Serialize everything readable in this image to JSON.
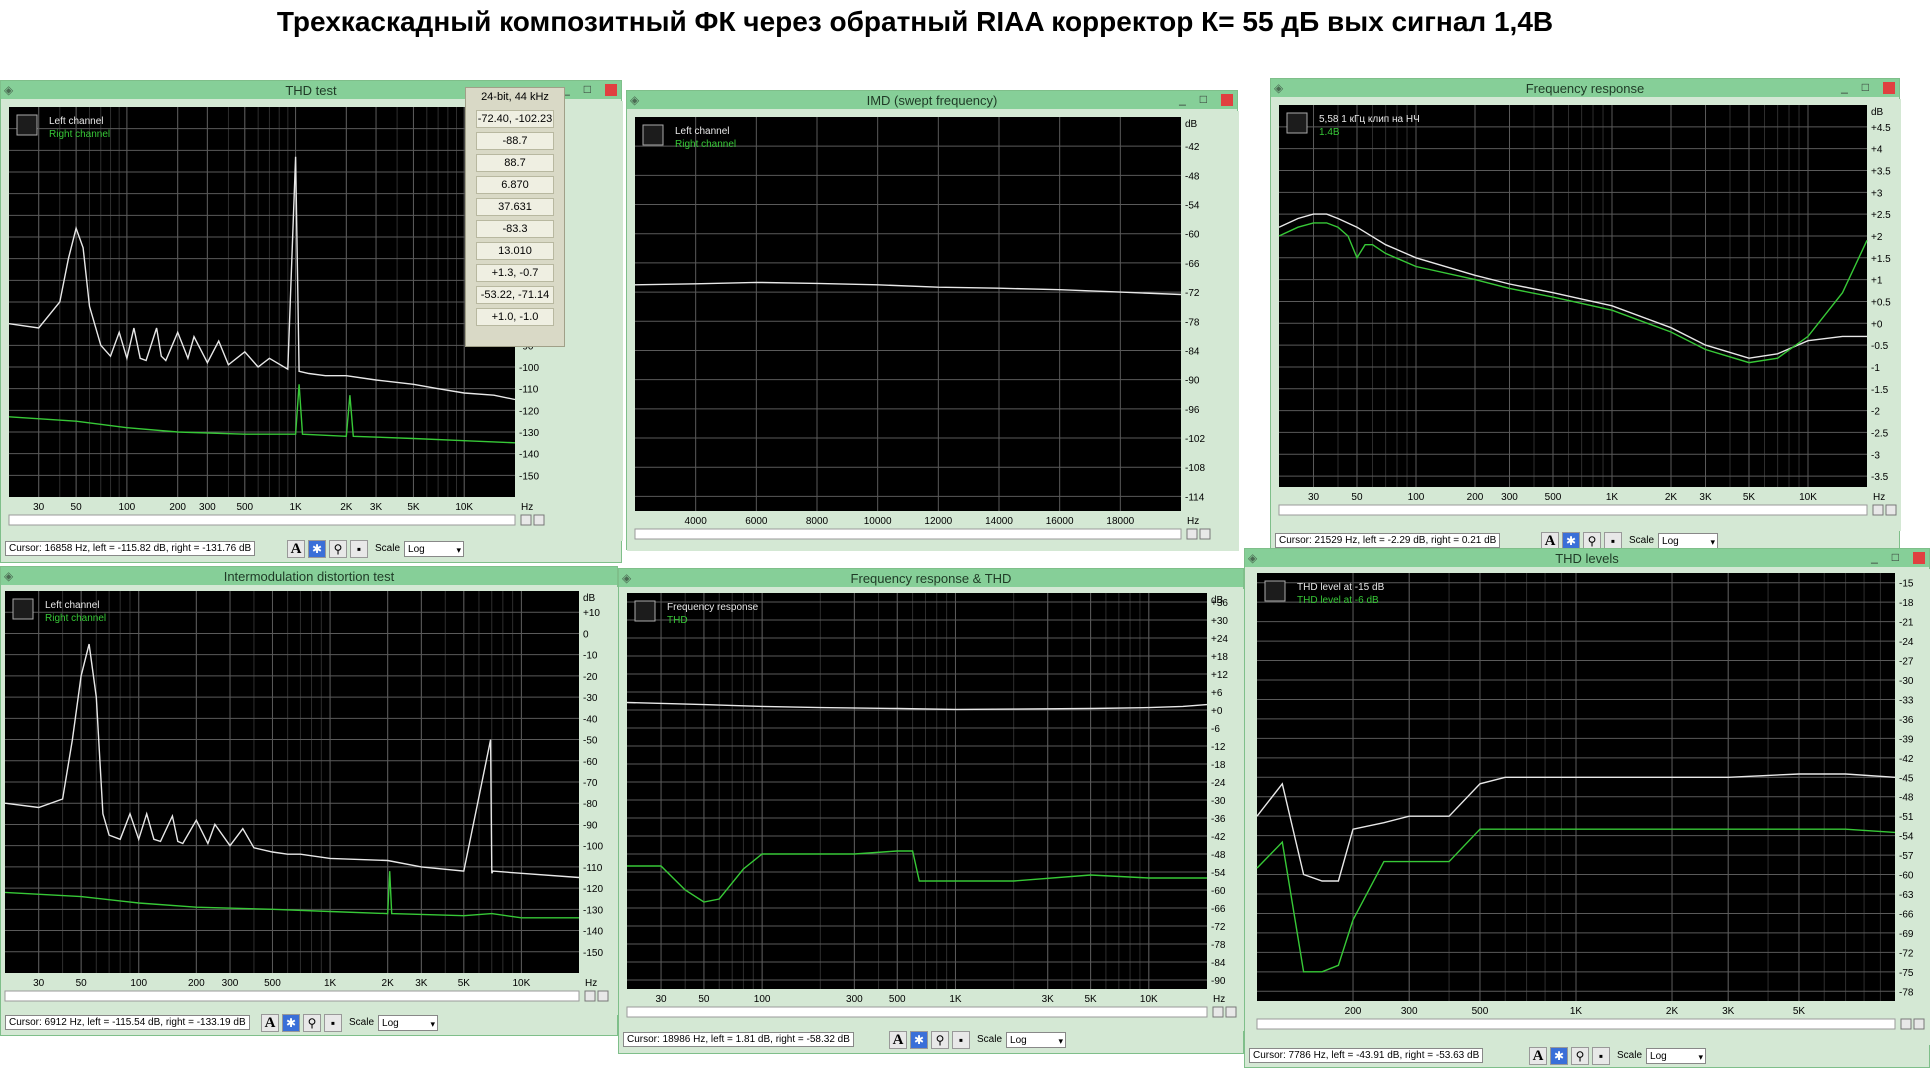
{
  "page_title": "Трехкаскадный композитный ФК через обратный  RIAA корректор К= 55 дБ  вых сигнал 1,4В",
  "colors": {
    "plot_bg": "#000000",
    "grid": "#5a5a5a",
    "left": "#e8e8e8",
    "right": "#37c837",
    "window": "#d4e8d4",
    "titlebar": "#86cf98"
  },
  "scale": {
    "label": "Scale",
    "value": "Log"
  },
  "windows": {
    "thd_test": {
      "title": "THD test",
      "legend": [
        "Left channel",
        "Right channel"
      ],
      "cursor": "Cursor:  16858 Hz,  left = -115.82 dB,  right = -131.76 dB",
      "panel": {
        "header": "24-bit, 44 kHz",
        "values": [
          "-72.40, -102.23",
          "-88.7",
          "88.7",
          "6.870",
          "37.631",
          "-83.3",
          "13.010",
          "+1.3, -0.7",
          "-53.22, -71.14",
          "+1.0, -1.0"
        ]
      }
    },
    "imd_swept": {
      "title": "IMD (swept frequency)",
      "legend": [
        "Left channel",
        "Right channel"
      ],
      "cursor": ""
    },
    "freq_response": {
      "title": "Frequency response",
      "legend": [
        "5,58 1 кГц клип на НЧ",
        "1.4В"
      ],
      "cursor": "Cursor:  21529 Hz,  left = -2.29 dB,  right = 0.21 dB"
    },
    "imd_test": {
      "title": "Intermodulation distortion test",
      "legend": [
        "Left channel",
        "Right channel"
      ],
      "cursor": "Cursor:  6912 Hz,  left = -115.54 dB,  right = -133.19 dB"
    },
    "fr_thd": {
      "title": "Frequency response & THD",
      "legend": [
        "Frequency response",
        "THD"
      ],
      "cursor": "Cursor:  18986 Hz,  left = 1.81 dB,  right = -58.32 dB"
    },
    "thd_levels": {
      "title": "THD levels",
      "legend": [
        "THD level at -15 dB",
        "THD level at -6 dB"
      ],
      "cursor": "Cursor:  7786 Hz,  left = -43.91 dB,  right = -53.63 dB"
    }
  },
  "chart_data": [
    {
      "id": "thd_test",
      "type": "line",
      "xscale": "log",
      "xlim": [
        20,
        20000
      ],
      "xticks": [
        {
          "v": 30,
          "l": "30"
        },
        {
          "v": 50,
          "l": "50"
        },
        {
          "v": 100,
          "l": "100"
        },
        {
          "v": 200,
          "l": "200"
        },
        {
          "v": 300,
          "l": "300"
        },
        {
          "v": 500,
          "l": "500"
        },
        {
          "v": 1000,
          "l": "1K"
        },
        {
          "v": 2000,
          "l": "2K"
        },
        {
          "v": 3000,
          "l": "3K"
        },
        {
          "v": 5000,
          "l": "5K"
        },
        {
          "v": 10000,
          "l": "10K"
        }
      ],
      "xunit": "Hz",
      "yticks": [
        "+10",
        "0",
        "-10",
        "-20",
        "-30",
        "-40",
        "-50",
        "-60",
        "-70",
        "-80",
        "-90",
        "-100",
        "-110",
        "-120",
        "-130",
        "-140",
        "-150"
      ],
      "yunit": "dB",
      "ylim": [
        -160,
        20
      ],
      "series": [
        {
          "name": "Left channel",
          "x": [
            20,
            30,
            40,
            45,
            50,
            55,
            60,
            70,
            80,
            90,
            100,
            110,
            120,
            130,
            150,
            160,
            170,
            200,
            230,
            250,
            300,
            350,
            400,
            500,
            600,
            700,
            900,
            1000,
            1050,
            1200,
            1500,
            2000,
            3000,
            5000,
            7000,
            10000,
            15000,
            20000
          ],
          "y": [
            -80,
            -82,
            -70,
            -50,
            -36,
            -45,
            -72,
            -90,
            -95,
            -84,
            -96,
            -82,
            -96,
            -97,
            -82,
            -95,
            -97,
            -84,
            -96,
            -86,
            -98,
            -88,
            -99,
            -93,
            -100,
            -96,
            -101,
            -3,
            -102,
            -103,
            -104,
            -104,
            -106,
            -108,
            -110,
            -112,
            -113,
            -115
          ]
        },
        {
          "name": "Right channel",
          "x": [
            20,
            50,
            100,
            200,
            500,
            1000,
            1050,
            1100,
            2000,
            2100,
            2200,
            5000,
            10000,
            20000
          ],
          "y": [
            -123,
            -125,
            -128,
            -130,
            -131,
            -131,
            -108,
            -131,
            -132,
            -113,
            -132,
            -133,
            -134,
            -135
          ]
        }
      ]
    },
    {
      "id": "imd_swept",
      "type": "line",
      "xscale": "linear",
      "xlim": [
        2000,
        20000
      ],
      "xticks": [
        {
          "v": 4000,
          "l": "4000"
        },
        {
          "v": 6000,
          "l": "6000"
        },
        {
          "v": 8000,
          "l": "8000"
        },
        {
          "v": 10000,
          "l": "10000"
        },
        {
          "v": 12000,
          "l": "12000"
        },
        {
          "v": 14000,
          "l": "14000"
        },
        {
          "v": 16000,
          "l": "16000"
        },
        {
          "v": 18000,
          "l": "18000"
        }
      ],
      "xunit": "Hz",
      "yticks": [
        "-42",
        "-48",
        "-54",
        "-60",
        "-66",
        "-72",
        "-78",
        "-84",
        "-90",
        "-96",
        "-102",
        "-108",
        "-114"
      ],
      "yunit": "dB",
      "ylim": [
        -117,
        -36
      ],
      "series": [
        {
          "name": "Left channel",
          "x": [
            2000,
            4000,
            6000,
            8000,
            10000,
            12000,
            14000,
            16000,
            18000,
            20000
          ],
          "y": [
            -70.5,
            -70.3,
            -70.0,
            -70.2,
            -70.5,
            -71,
            -71.2,
            -71.5,
            -72,
            -72.5
          ]
        }
      ]
    },
    {
      "id": "freq_response",
      "type": "line",
      "xscale": "log",
      "xlim": [
        20,
        20000
      ],
      "xticks": [
        {
          "v": 30,
          "l": "30"
        },
        {
          "v": 50,
          "l": "50"
        },
        {
          "v": 100,
          "l": "100"
        },
        {
          "v": 200,
          "l": "200"
        },
        {
          "v": 300,
          "l": "300"
        },
        {
          "v": 500,
          "l": "500"
        },
        {
          "v": 1000,
          "l": "1K"
        },
        {
          "v": 2000,
          "l": "2K"
        },
        {
          "v": 3000,
          "l": "3K"
        },
        {
          "v": 5000,
          "l": "5K"
        },
        {
          "v": 10000,
          "l": "10K"
        }
      ],
      "xunit": "Hz",
      "yticks": [
        "+4.5",
        "+4",
        "+3.5",
        "+3",
        "+2.5",
        "+2",
        "+1.5",
        "+1",
        "+0.5",
        "+0",
        "-0.5",
        "-1",
        "-1.5",
        "-2",
        "-2.5",
        "-3",
        "-3.5"
      ],
      "yunit": "dB",
      "ylim": [
        -3.75,
        5
      ],
      "series": [
        {
          "name": "5,58 1 кГц клип на НЧ",
          "x": [
            20,
            25,
            30,
            35,
            40,
            50,
            70,
            100,
            200,
            300,
            500,
            1000,
            2000,
            3000,
            5000,
            7000,
            10000,
            15000,
            20000
          ],
          "y": [
            2.2,
            2.4,
            2.5,
            2.5,
            2.4,
            2.2,
            1.8,
            1.5,
            1.1,
            0.9,
            0.7,
            0.4,
            -0.1,
            -0.5,
            -0.8,
            -0.7,
            -0.4,
            -0.3,
            -0.3
          ]
        },
        {
          "name": "1.4В",
          "x": [
            20,
            25,
            30,
            35,
            40,
            45,
            50,
            55,
            60,
            70,
            100,
            200,
            300,
            500,
            1000,
            2000,
            3000,
            5000,
            7000,
            10000,
            15000,
            20000
          ],
          "y": [
            2.0,
            2.2,
            2.3,
            2.3,
            2.2,
            2.0,
            1.5,
            1.8,
            1.8,
            1.6,
            1.3,
            1.0,
            0.8,
            0.6,
            0.3,
            -0.2,
            -0.6,
            -0.9,
            -0.8,
            -0.3,
            0.7,
            1.9
          ]
        }
      ]
    },
    {
      "id": "imd_test",
      "type": "line",
      "xscale": "log",
      "xlim": [
        20,
        20000
      ],
      "xticks": [
        {
          "v": 30,
          "l": "30"
        },
        {
          "v": 50,
          "l": "50"
        },
        {
          "v": 100,
          "l": "100"
        },
        {
          "v": 200,
          "l": "200"
        },
        {
          "v": 300,
          "l": "300"
        },
        {
          "v": 500,
          "l": "500"
        },
        {
          "v": 1000,
          "l": "1K"
        },
        {
          "v": 2000,
          "l": "2K"
        },
        {
          "v": 3000,
          "l": "3K"
        },
        {
          "v": 5000,
          "l": "5K"
        },
        {
          "v": 10000,
          "l": "10K"
        }
      ],
      "xunit": "Hz",
      "yticks": [
        "+10",
        "0",
        "-10",
        "-20",
        "-30",
        "-40",
        "-50",
        "-60",
        "-70",
        "-80",
        "-90",
        "-100",
        "-110",
        "-120",
        "-130",
        "-140",
        "-150"
      ],
      "yunit": "dB",
      "ylim": [
        -160,
        20
      ],
      "series": [
        {
          "name": "Left channel",
          "x": [
            20,
            30,
            40,
            45,
            50,
            55,
            60,
            65,
            70,
            80,
            90,
            100,
            110,
            120,
            130,
            150,
            160,
            170,
            200,
            230,
            250,
            300,
            350,
            400,
            500,
            600,
            700,
            1000,
            2000,
            3000,
            5000,
            6900,
            7000,
            7100,
            10000,
            20000
          ],
          "y": [
            -80,
            -82,
            -78,
            -50,
            -20,
            -5,
            -30,
            -85,
            -95,
            -97,
            -85,
            -97,
            -85,
            -97,
            -98,
            -86,
            -98,
            -99,
            -88,
            -99,
            -90,
            -100,
            -92,
            -101,
            -103,
            -104,
            -104,
            -106,
            -107,
            -110,
            -112,
            -50,
            -113,
            -112,
            -113,
            -115
          ]
        },
        {
          "name": "Right channel",
          "x": [
            20,
            50,
            100,
            200,
            500,
            1000,
            2000,
            2050,
            2100,
            5000,
            7000,
            10000,
            20000
          ],
          "y": [
            -122,
            -124,
            -127,
            -129,
            -130,
            -131,
            -132,
            -112,
            -132,
            -133,
            -132,
            -134,
            -134
          ]
        }
      ]
    },
    {
      "id": "fr_thd",
      "type": "line",
      "xscale": "log",
      "xlim": [
        20,
        20000
      ],
      "xticks": [
        {
          "v": 30,
          "l": "30"
        },
        {
          "v": 50,
          "l": "50"
        },
        {
          "v": 100,
          "l": "100"
        },
        {
          "v": 300,
          "l": "300"
        },
        {
          "v": 500,
          "l": "500"
        },
        {
          "v": 1000,
          "l": "1K"
        },
        {
          "v": 3000,
          "l": "3K"
        },
        {
          "v": 5000,
          "l": "5K"
        },
        {
          "v": 10000,
          "l": "10K"
        }
      ],
      "xunit": "Hz",
      "yticks": [
        "+36",
        "+30",
        "+24",
        "+18",
        "+12",
        "+6",
        "+0",
        "-6",
        "-12",
        "-18",
        "-24",
        "-30",
        "-36",
        "-42",
        "-48",
        "-54",
        "-60",
        "-66",
        "-72",
        "-78",
        "-84",
        "-90"
      ],
      "yunit": "dB",
      "ylim": [
        -93,
        39
      ],
      "series": [
        {
          "name": "Frequency response",
          "x": [
            20,
            50,
            100,
            200,
            500,
            1000,
            2000,
            5000,
            10000,
            15000,
            20000
          ],
          "y": [
            2.5,
            1.8,
            1.2,
            0.8,
            0.5,
            0.2,
            0.3,
            0.5,
            0.8,
            1.2,
            1.8
          ]
        },
        {
          "name": "THD",
          "x": [
            20,
            30,
            40,
            50,
            60,
            80,
            100,
            150,
            200,
            300,
            500,
            600,
            650,
            700,
            1000,
            2000,
            5000,
            10000,
            20000
          ],
          "y": [
            -52,
            -52,
            -60,
            -64,
            -63,
            -53,
            -48,
            -48,
            -48,
            -48,
            -47,
            -47,
            -57,
            -57,
            -57,
            -57,
            -55,
            -56,
            -56
          ]
        }
      ]
    },
    {
      "id": "thd_levels",
      "type": "line",
      "xscale": "log",
      "xlim": [
        100,
        10000
      ],
      "xticks": [
        {
          "v": 200,
          "l": "200"
        },
        {
          "v": 300,
          "l": "300"
        },
        {
          "v": 500,
          "l": "500"
        },
        {
          "v": 1000,
          "l": "1K"
        },
        {
          "v": 2000,
          "l": "2K"
        },
        {
          "v": 3000,
          "l": "3K"
        },
        {
          "v": 5000,
          "l": "5K"
        }
      ],
      "xunit": "",
      "yticks": [
        "-15",
        "-18",
        "-21",
        "-24",
        "-27",
        "-30",
        "-33",
        "-36",
        "-39",
        "-42",
        "-45",
        "-48",
        "-51",
        "-54",
        "-57",
        "-60",
        "-63",
        "-66",
        "-69",
        "-72",
        "-75",
        "-78"
      ],
      "yunit": "",
      "ylim": [
        -79.5,
        -13.5
      ],
      "series": [
        {
          "name": "THD level at -15 dB",
          "x": [
            100,
            120,
            140,
            160,
            180,
            200,
            250,
            300,
            400,
            500,
            600,
            700,
            1000,
            2000,
            3000,
            5000,
            7000,
            10000
          ],
          "y": [
            -51,
            -46,
            -60,
            -61,
            -61,
            -53,
            -52,
            -51,
            -51,
            -46,
            -45,
            -45,
            -45,
            -45,
            -45,
            -44.5,
            -44.5,
            -45
          ]
        },
        {
          "name": "THD level at -6 dB",
          "x": [
            100,
            120,
            140,
            160,
            180,
            200,
            250,
            300,
            400,
            500,
            600,
            700,
            1000,
            2000,
            3000,
            5000,
            7000,
            10000
          ],
          "y": [
            -59,
            -55,
            -75,
            -75,
            -74,
            -67,
            -58,
            -58,
            -58,
            -53,
            -53,
            -53,
            -53,
            -53,
            -53,
            -53,
            -53,
            -53.5
          ]
        }
      ]
    }
  ]
}
